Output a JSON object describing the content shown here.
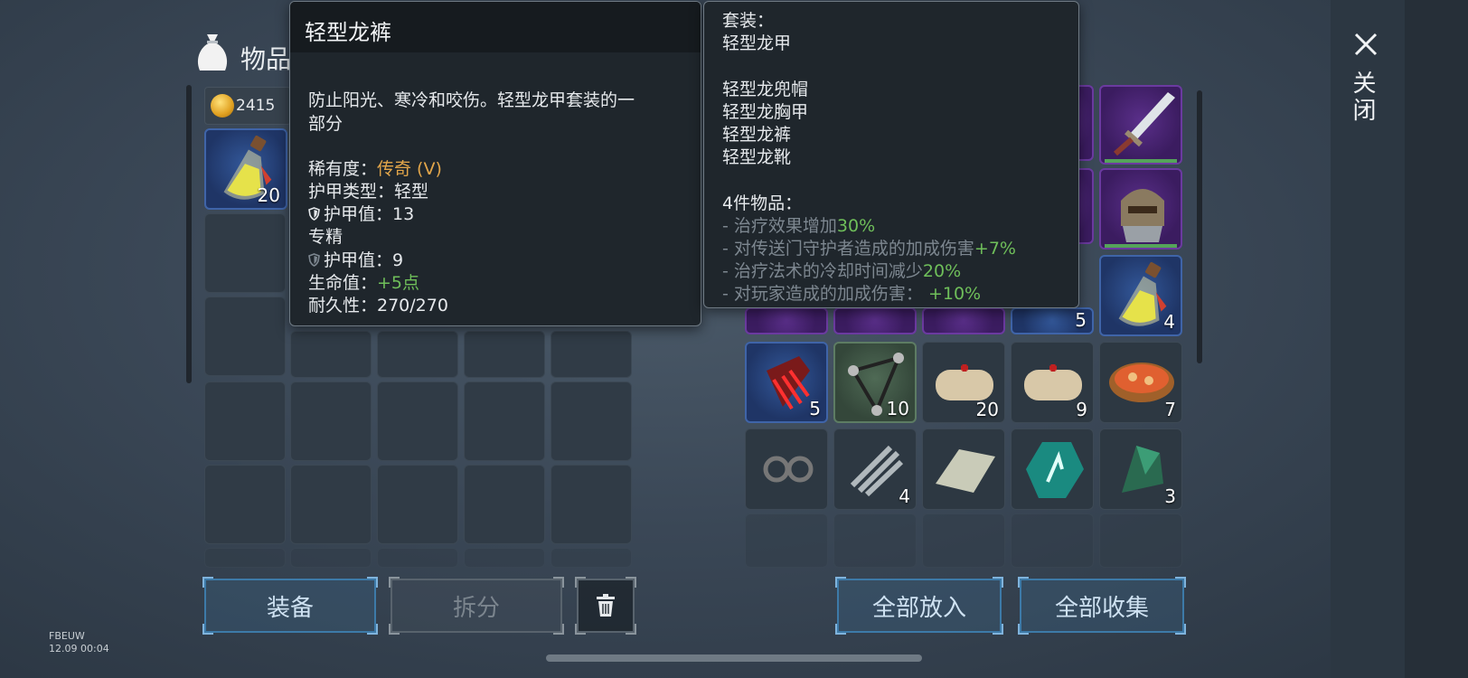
{
  "header": {
    "title": "物品"
  },
  "currency": {
    "gold": "2415"
  },
  "left_inventory": {
    "potion_qty": "20"
  },
  "tooltip_item": {
    "name": "轻型龙裤",
    "description_line1": "防止阳光、寒冷和咬伤。轻型龙甲套装的一",
    "description_line2": "部分",
    "rarity_label": "稀有度：",
    "rarity_value": "传奇 (V)",
    "armor_type": "护甲类型：轻型",
    "armor_value": "护甲值：13",
    "specialization": "专精",
    "spec_armor_value": "护甲值：9",
    "hp_label": "生命值：",
    "hp_value": "+5点",
    "durability": "耐久性：270/270"
  },
  "tooltip_set": {
    "set_label": "套装：",
    "set_name": "轻型龙甲",
    "pieces": [
      "轻型龙兜帽",
      "轻型龙胸甲",
      "轻型龙裤",
      "轻型龙靴"
    ],
    "bonus_header": "4件物品：",
    "bonuses": [
      {
        "text": "- 治疗效果增加",
        "value": "30%"
      },
      {
        "text": "- 对传送门守护者造成的加成伤害",
        "value": "+7%"
      },
      {
        "text": "- 治疗法术的冷却时间减少",
        "value": "20%"
      },
      {
        "text": "- 对玩家造成的加成伤害：",
        "value": "+10%"
      }
    ]
  },
  "right_inventory": {
    "row3_qty": [
      "5",
      "4"
    ],
    "row4_qty": [
      "5",
      "10",
      "20",
      "9",
      "7"
    ],
    "row5_qty": [
      "4",
      "3"
    ]
  },
  "buttons": {
    "equip": "装备",
    "split": "拆分",
    "put_all": "全部放入",
    "collect_all": "全部收集"
  },
  "side": {
    "close_label": "关闭"
  },
  "footer": {
    "server": "FBEUW",
    "datetime": "12.09 00:04"
  },
  "colors": {
    "rarity": "#e3a64a",
    "bonus_green": "#6fbf5a",
    "button_border": "#3d7aa8"
  }
}
